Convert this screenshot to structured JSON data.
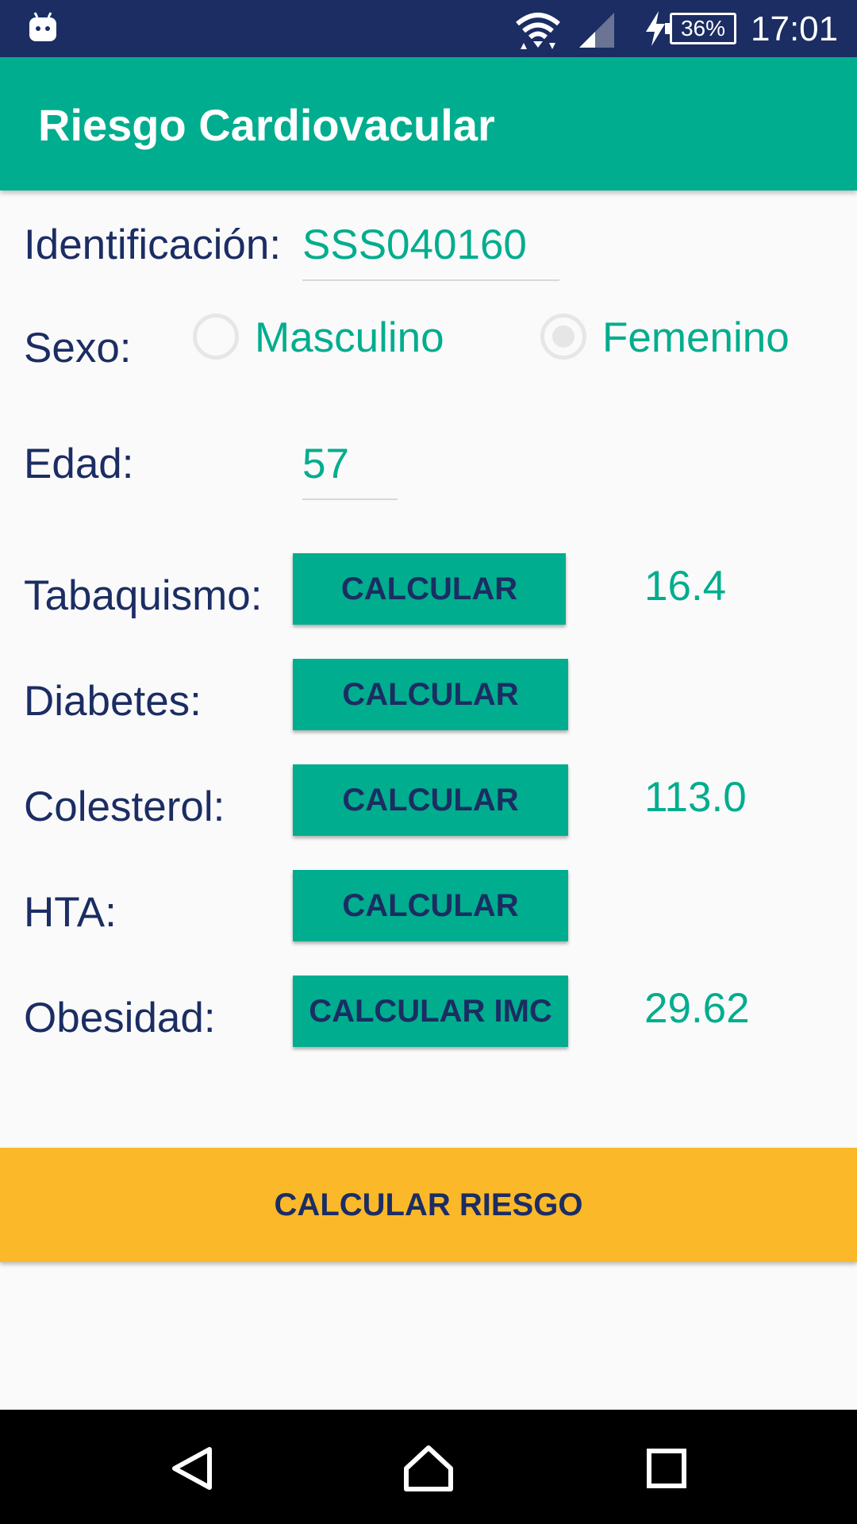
{
  "status_bar": {
    "time": "17:01",
    "battery": "36%",
    "icons": [
      "android-icon",
      "wifi-icon",
      "signal-icon",
      "charging-icon",
      "battery-icon"
    ]
  },
  "app_bar": {
    "title": "Riesgo Cardiovacular"
  },
  "form": {
    "identificacion": {
      "label": "Identificación:",
      "value": "SSS040160"
    },
    "sexo": {
      "label": "Sexo:",
      "options": [
        "Masculino",
        "Femenino"
      ],
      "selected": "Femenino"
    },
    "edad": {
      "label": "Edad:",
      "value": "57"
    },
    "factors": [
      {
        "label": "Tabaquismo:",
        "button": "CALCULAR",
        "result": "16.4"
      },
      {
        "label": "Diabetes:",
        "button": "CALCULAR",
        "result": ""
      },
      {
        "label": "Colesterol:",
        "button": "CALCULAR",
        "result": "113.0"
      },
      {
        "label": "HTA:",
        "button": "CALCULAR",
        "result": ""
      },
      {
        "label": "Obesidad:",
        "button": "CALCULAR IMC",
        "result": "29.62"
      }
    ]
  },
  "actions": {
    "calculate_risk": "CALCULAR RIESGO"
  },
  "nav": {
    "icons": [
      "back-icon",
      "home-icon",
      "recents-icon"
    ]
  },
  "colors": {
    "primary": "#00ad8e",
    "dark": "#1b2d63",
    "accent": "#fbb829"
  }
}
